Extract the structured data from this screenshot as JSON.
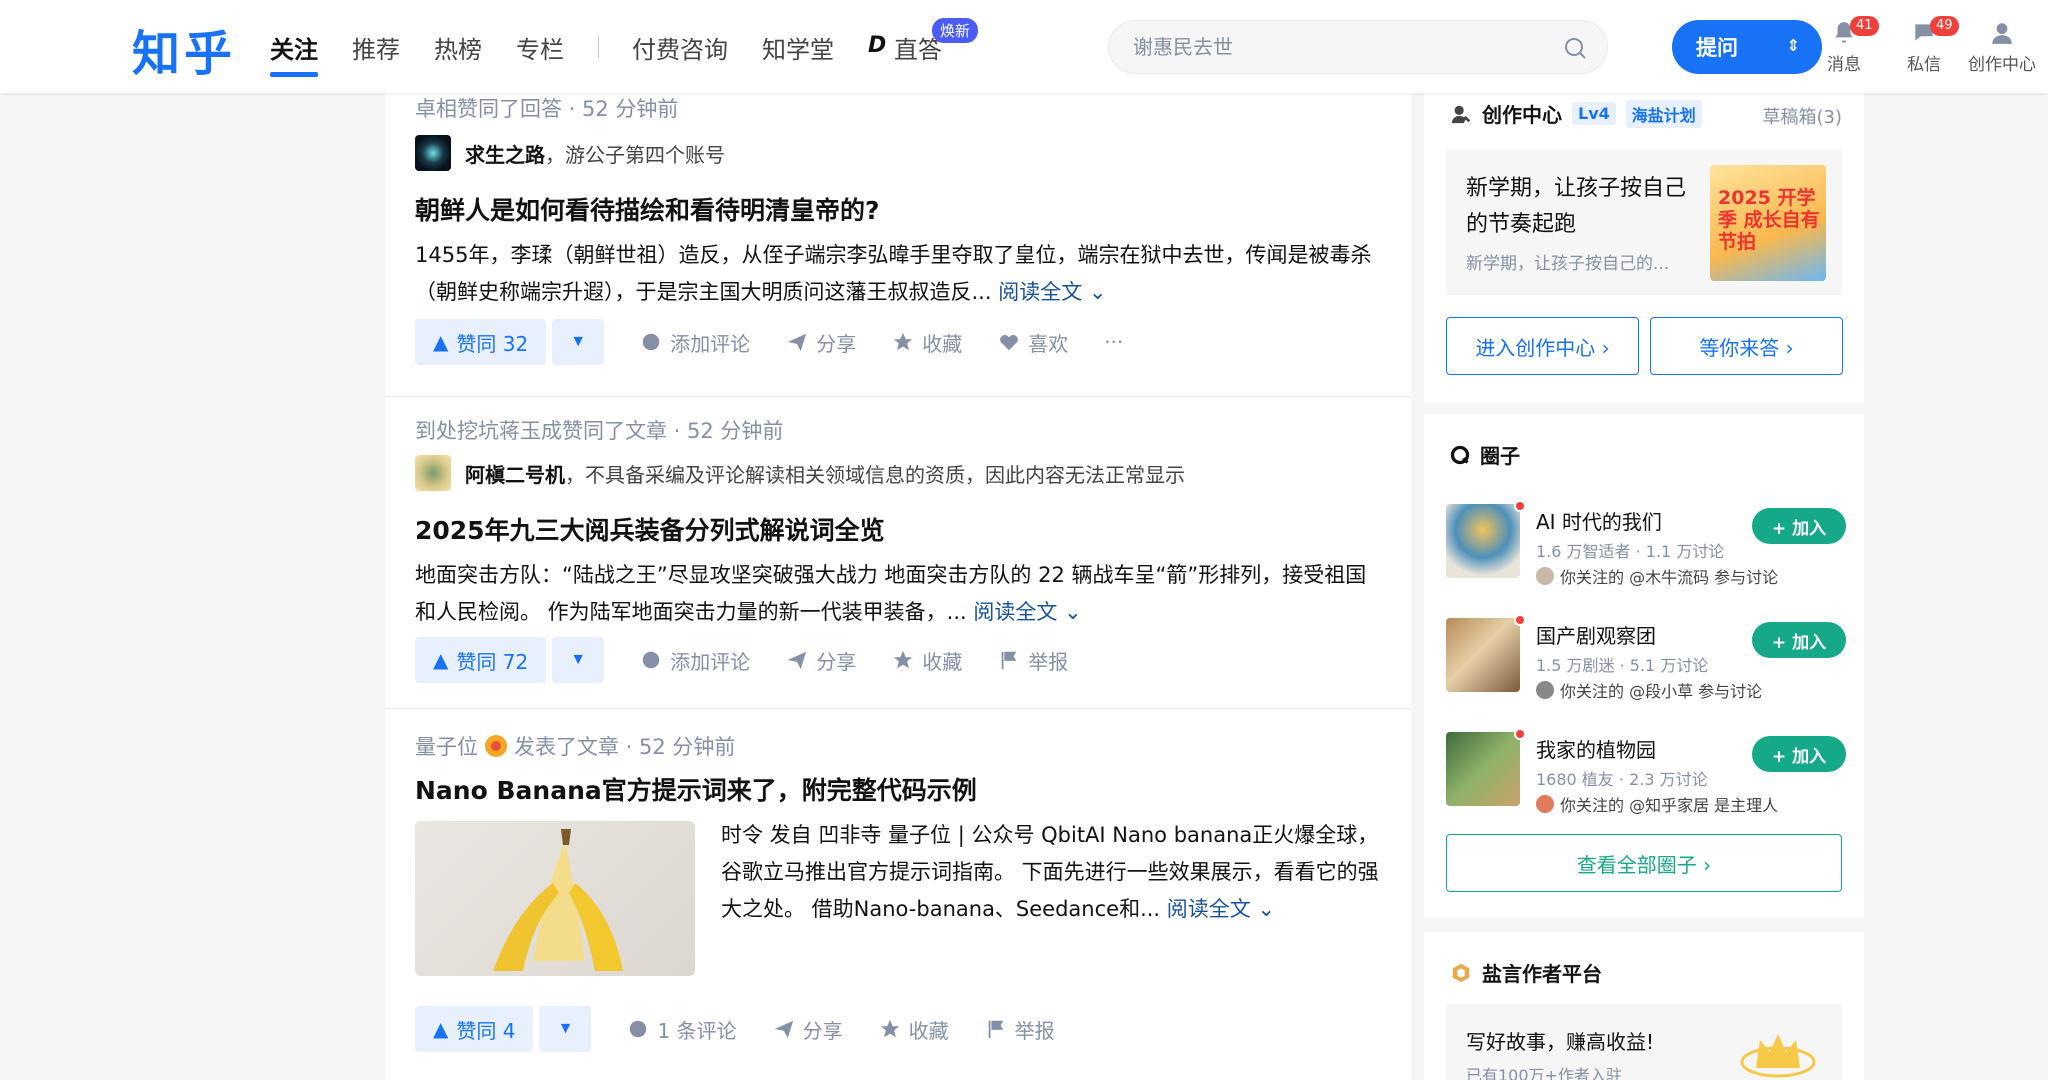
{
  "header": {
    "logo": "知乎",
    "tabs": [
      {
        "label": "关注"
      },
      {
        "label": "推荐"
      },
      {
        "label": "热榜"
      },
      {
        "label": "专栏"
      },
      {
        "label": "付费咨询"
      },
      {
        "label": "知学堂"
      },
      {
        "label": "直答"
      }
    ],
    "zd_badge": "焕新",
    "search_placeholder": "谢惠民去世",
    "ask_label": "提问",
    "icons": [
      {
        "label": "消息",
        "count": "41"
      },
      {
        "label": "私信",
        "count": "49"
      },
      {
        "label": "创作中心"
      }
    ]
  },
  "feed": [
    {
      "meta": "卓相赞同了回答 · 52 分钟前",
      "author": "求生之路",
      "author_desc": "，游公子第四个账号",
      "title": "朝鲜人是如何看待描绘和看待明清皇帝的?",
      "excerpt": "1455年，李瑈（朝鲜世祖）造反，从侄子端宗李弘暐手里夺取了皇位，端宗在狱中去世，传闻是被毒杀（朝鲜史称端宗升遐），于是宗主国大明质问这藩王叔叔造反...",
      "read_more": "阅读全文",
      "vote": "赞同 32",
      "actions": [
        "添加评论",
        "分享",
        "收藏",
        "喜欢"
      ],
      "more": "···"
    },
    {
      "meta": "到处挖坑蒋玉成赞同了文章 · 52 分钟前",
      "author": "阿槇二号机",
      "author_desc": "，不具备采编及评论解读相关领域信息的资质，因此内容无法正常显示",
      "title": "2025年九三大阅兵装备分列式解说词全览",
      "excerpt": "地面突击方队：“陆战之王”尽显攻坚突破强大战力 地面突击方队的 22 辆战车呈“箭”形排列，接受祖国和人民检阅。 作为陆军地面突击力量的新一代装甲装备，...",
      "read_more": "阅读全文",
      "vote": "赞同 72",
      "actions": [
        "添加评论",
        "分享",
        "收藏",
        "举报"
      ]
    },
    {
      "meta_author": "量子位",
      "meta_rest": "发表了文章 · 52 分钟前",
      "title": "Nano Banana官方提示词来了，附完整代码示例",
      "excerpt": "时令 发自 凹非寺 量子位 | 公众号 QbitAI Nano banana正火爆全球，谷歌立马推出官方提示词指南。 下面先进行一些效果展示，看看它的强大之处。 借助Nano-banana、Seedance和...",
      "read_more": "阅读全文",
      "vote": "赞同 4",
      "actions": [
        "1 条评论",
        "分享",
        "收藏",
        "举报"
      ]
    }
  ],
  "sidebar": {
    "creator": {
      "title": "创作中心",
      "level": "Lv4",
      "plan": "海盐计划",
      "drafts": "草稿箱(3)",
      "promo_title": "新学期，让孩子按自己的节奏起跑",
      "promo_sub": "新学期，让孩子按自己的...",
      "promo_img_text": "2025 开学季 成长自有节拍",
      "btn_enter": "进入创作中心 ›",
      "btn_answer": "等你来答 ›"
    },
    "circles": {
      "title": "圈子",
      "items": [
        {
          "name": "AI 时代的我们",
          "stats": "1.6 万智适者 · 1.1 万讨论",
          "follow": "你关注的 @木牛流码 参与讨论",
          "join": "+ 加入"
        },
        {
          "name": "国产剧观察团",
          "stats": "1.5 万剧迷 · 5.1 万讨论",
          "follow": "你关注的 @段小草 参与讨论",
          "join": "+ 加入"
        },
        {
          "name": "我家的植物园",
          "stats": "1680 植友 · 2.3 万讨论",
          "follow": "你关注的 @知乎家居 是主理人",
          "join": "+ 加入"
        }
      ],
      "view_all": "查看全部圈子 ›"
    },
    "writer": {
      "title": "盐言作者平台",
      "text": "写好故事，赚高收益!",
      "sub": "已有100万+作者入驻"
    }
  }
}
